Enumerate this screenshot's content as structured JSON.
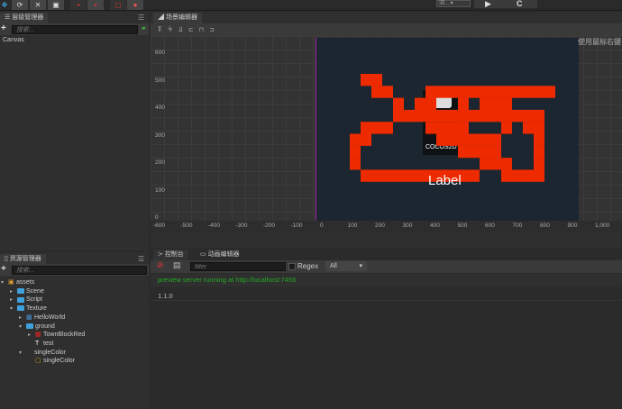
{
  "toolbar": {
    "buttons": [
      "move",
      "rotate",
      "scale",
      "rect",
      "anchor-local",
      "anchor-center",
      "web",
      "device"
    ],
    "platform_select": "浏...",
    "play_label": "▶",
    "refresh_label": "C"
  },
  "hierarchy": {
    "title": "层级管理器",
    "search_placeholder": "搜索...",
    "items": [
      "Canvas"
    ]
  },
  "scene": {
    "title": "场景编辑器",
    "hint": "使用鼠标右键",
    "y_ticks": [
      "600",
      "500",
      "400",
      "300",
      "200",
      "100",
      "0"
    ],
    "x_ticks": [
      "-600",
      "-500",
      "-400",
      "-300",
      "-200",
      "-100",
      "0",
      "100",
      "200",
      "300",
      "400",
      "500",
      "600",
      "700",
      "800",
      "900",
      "1,000"
    ],
    "label_text": "Label",
    "logo_text": "COCOS2D",
    "colors": {
      "canvas": "#1b2630",
      "tile": "#ee2a00",
      "border": "#a020a0"
    }
  },
  "assets": {
    "title": "资源管理器",
    "search_placeholder": "搜索...",
    "tree": [
      {
        "label": "assets",
        "depth": 0,
        "icon": "assets-icon",
        "expanded": true
      },
      {
        "label": "Scene",
        "depth": 1,
        "icon": "folder-icon",
        "expanded": false
      },
      {
        "label": "Script",
        "depth": 1,
        "icon": "folder-icon",
        "expanded": false
      },
      {
        "label": "Texture",
        "depth": 1,
        "icon": "folder-icon",
        "expanded": true
      },
      {
        "label": "HelloWorld",
        "depth": 2,
        "icon": "image-icon",
        "expanded": false
      },
      {
        "label": "ground",
        "depth": 2,
        "icon": "folder-icon",
        "expanded": true
      },
      {
        "label": "TownBlockRed",
        "depth": 3,
        "icon": "red-texture-icon",
        "expanded": false
      },
      {
        "label": "test",
        "depth": 3,
        "icon": "text-file-icon"
      },
      {
        "label": "singleColor",
        "depth": 2,
        "icon": "none",
        "expanded": true
      },
      {
        "label": "singleColor",
        "depth": 3,
        "icon": "sprite-frame-icon"
      }
    ]
  },
  "console": {
    "tab_console": "控制台",
    "tab_animation": "动画编辑器",
    "filter_placeholder": "filter",
    "regex_label": "Regex",
    "level_select": "All",
    "logs": [
      {
        "text": "preview server running at http://localhost:7456",
        "color": "#22aa22"
      },
      {
        "text": "1.1.0",
        "color": "#bbbbbb"
      }
    ]
  }
}
